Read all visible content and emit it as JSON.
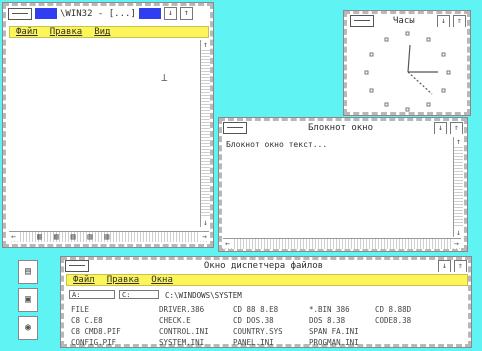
{
  "explorer": {
    "title": "\\WIN32 - [...]",
    "menu": [
      "Файл",
      "Правка",
      "Вид"
    ],
    "up_arrow": "↑",
    "down_arrow": "↓",
    "left_arrow": "←",
    "right_arrow": "→",
    "tab_buttons": [
      "▥",
      "▥",
      "▥",
      "▥",
      "▥"
    ]
  },
  "clock": {
    "title": "Часы",
    "btn_min": "↓",
    "btn_max": "⇑"
  },
  "notepad": {
    "title": "Блокнот окно",
    "content": "Блокнот окно текст...",
    "btn_min": "↓",
    "btn_max": "⇑"
  },
  "filemgr": {
    "title": "Окно диспетчера файлов",
    "menu": [
      "Файл",
      "Правка",
      "Окна"
    ],
    "path_left": "A:",
    "path_mid": "C:",
    "path_label": "C:\\WINDOWS\\SYSTEM",
    "btn_min": "↓",
    "btn_max": "⇑",
    "rows": [
      [
        "FILE",
        "DRIVER.386",
        "CD 88 8.E8",
        "*.BIN 386",
        "CD 8.88D"
      ],
      [
        "C8 C.E8",
        "CHECK.E",
        "CD DOS.38",
        "DOS 8.38",
        "CODE8.38"
      ],
      [
        "C8 CMD8.PIF",
        "CONTROL.INI",
        "COUNTRY.SYS",
        "SPAN FA.INI",
        ""
      ],
      [
        "CONFIG.PIF",
        "SYSTEM.INI",
        "PANEL.INI",
        "PROGMAN.INI",
        ""
      ]
    ]
  },
  "desktop_icons": [
    "▤",
    "▣",
    "◉"
  ],
  "colors": {
    "desktop": "#5ff3f3",
    "menubar": "#fbf55a",
    "title_accent": "#2f3ef0"
  }
}
